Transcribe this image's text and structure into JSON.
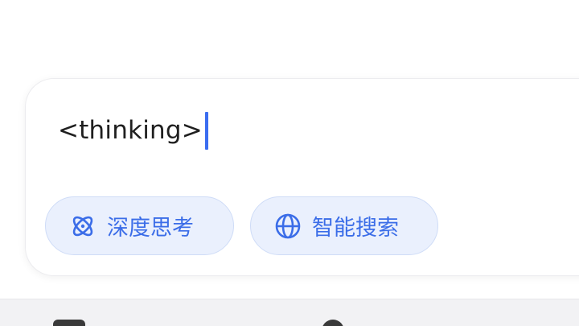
{
  "composer": {
    "input_value": "<thinking>",
    "chips": [
      {
        "label": "深度思考",
        "icon": "atom-icon"
      },
      {
        "label": "智能搜索",
        "icon": "globe-icon"
      }
    ]
  },
  "colors": {
    "accent": "#3b6de8",
    "chip_background": "#eaf0fd",
    "chip_border": "#cfdcf7",
    "caret": "#3b6df0"
  },
  "bottom_bar": {
    "icons": [
      "toolbar-icon",
      "toolbar-icon"
    ]
  }
}
